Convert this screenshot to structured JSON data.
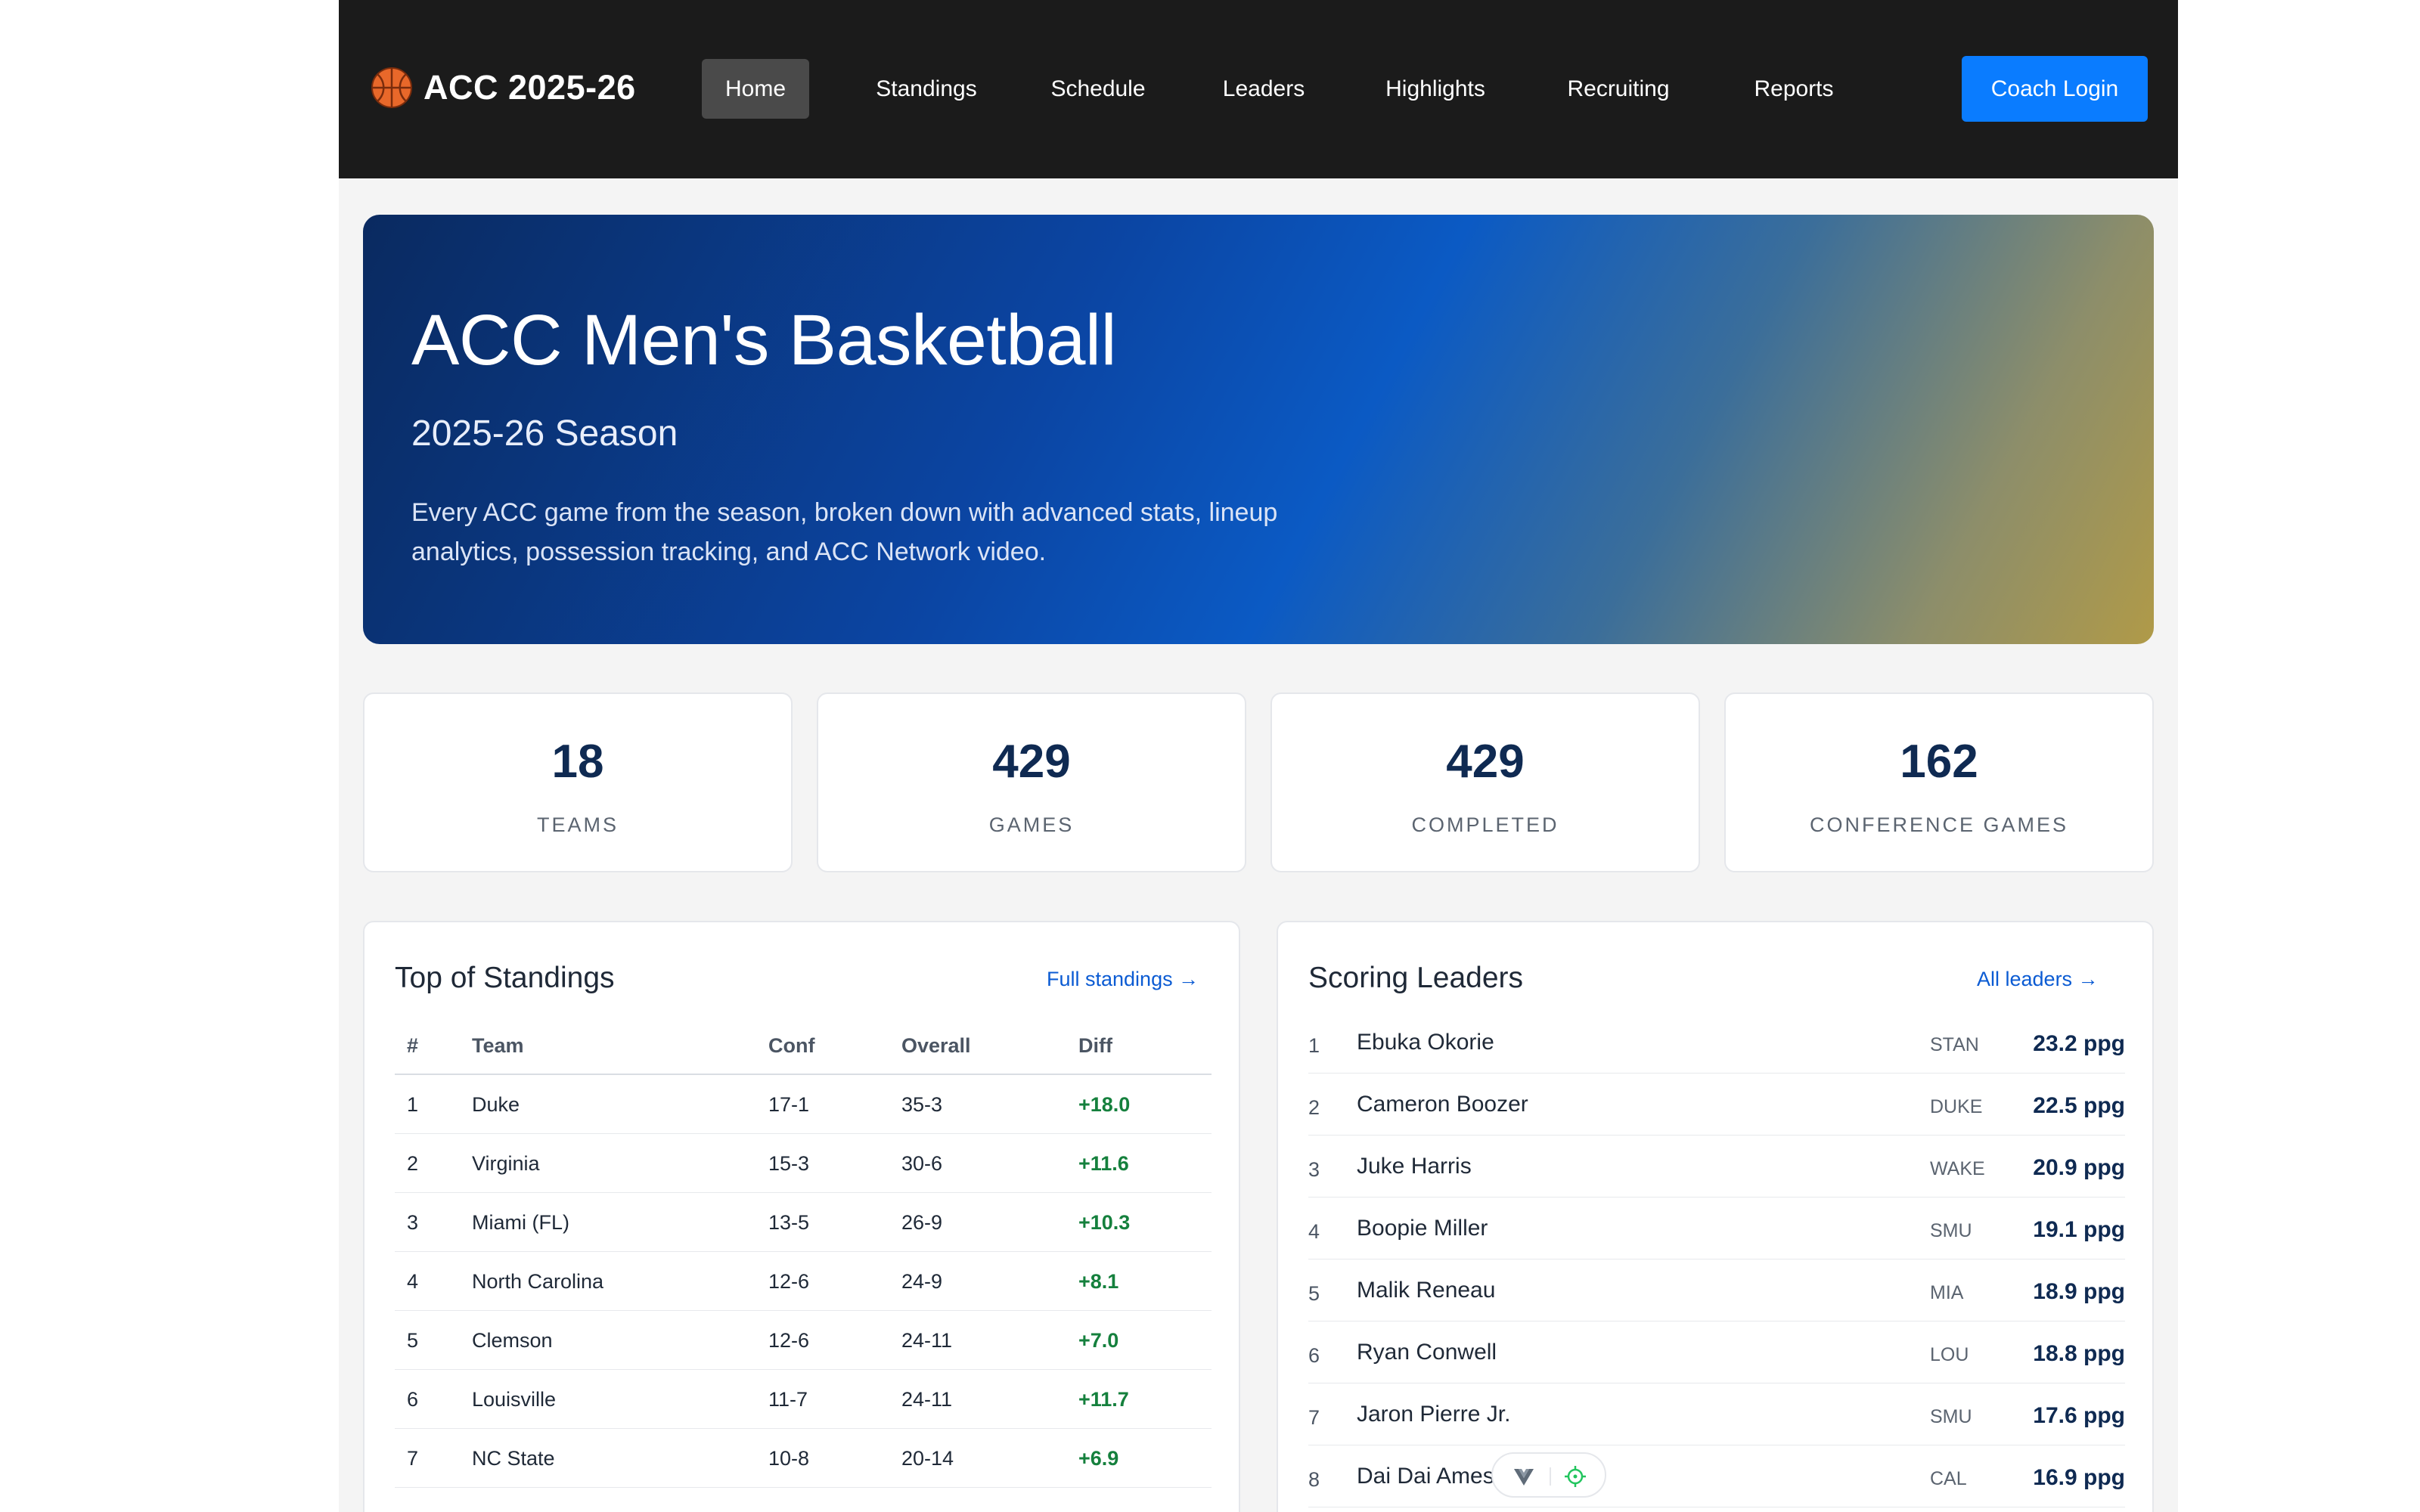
{
  "nav": {
    "brand": "ACC 2025-26",
    "brand_icon": "basketball-icon",
    "items": [
      {
        "label": "Home",
        "active": true
      },
      {
        "label": "Standings",
        "active": false
      },
      {
        "label": "Schedule",
        "active": false
      },
      {
        "label": "Leaders",
        "active": false
      },
      {
        "label": "Highlights",
        "active": false
      },
      {
        "label": "Recruiting",
        "active": false
      },
      {
        "label": "Reports",
        "active": false
      }
    ],
    "login_label": "Coach Login"
  },
  "hero": {
    "title": "ACC Men's Basketball",
    "subtitle": "2025-26 Season",
    "description": "Every ACC game from the season, broken down with advanced stats, lineup analytics, possession tracking, and ACC Network video."
  },
  "stats": [
    {
      "value": "18",
      "label": "TEAMS"
    },
    {
      "value": "429",
      "label": "GAMES"
    },
    {
      "value": "429",
      "label": "COMPLETED"
    },
    {
      "value": "162",
      "label": "CONFERENCE GAMES"
    }
  ],
  "standings": {
    "title": "Top of Standings",
    "link": "Full standings →",
    "columns": [
      "#",
      "Team",
      "Conf",
      "Overall",
      "Diff"
    ],
    "rows": [
      {
        "rank": "1",
        "team": "Duke",
        "conf": "17-1",
        "overall": "35-3",
        "diff": "+18.0"
      },
      {
        "rank": "2",
        "team": "Virginia",
        "conf": "15-3",
        "overall": "30-6",
        "diff": "+11.6"
      },
      {
        "rank": "3",
        "team": "Miami (FL)",
        "conf": "13-5",
        "overall": "26-9",
        "diff": "+10.3"
      },
      {
        "rank": "4",
        "team": "North Carolina",
        "conf": "12-6",
        "overall": "24-9",
        "diff": "+8.1"
      },
      {
        "rank": "5",
        "team": "Clemson",
        "conf": "12-6",
        "overall": "24-11",
        "diff": "+7.0"
      },
      {
        "rank": "6",
        "team": "Louisville",
        "conf": "11-7",
        "overall": "24-11",
        "diff": "+11.7"
      },
      {
        "rank": "7",
        "team": "NC State",
        "conf": "10-8",
        "overall": "20-14",
        "diff": "+6.9"
      }
    ]
  },
  "leaders": {
    "title": "Scoring Leaders",
    "link": "All leaders →",
    "rows": [
      {
        "rank": "1",
        "name": "Ebuka Okorie",
        "team": "STAN",
        "value": "23.2 ppg"
      },
      {
        "rank": "2",
        "name": "Cameron Boozer",
        "team": "DUKE",
        "value": "22.5 ppg"
      },
      {
        "rank": "3",
        "name": "Juke Harris",
        "team": "WAKE",
        "value": "20.9 ppg"
      },
      {
        "rank": "4",
        "name": "Boopie Miller",
        "team": "SMU",
        "value": "19.1 ppg"
      },
      {
        "rank": "5",
        "name": "Malik Reneau",
        "team": "MIA",
        "value": "18.9 ppg"
      },
      {
        "rank": "6",
        "name": "Ryan Conwell",
        "team": "LOU",
        "value": "18.8 ppg"
      },
      {
        "rank": "7",
        "name": "Jaron Pierre Jr.",
        "team": "SMU",
        "value": "17.6 ppg"
      },
      {
        "rank": "8",
        "name": "Dai Dai Ames",
        "team": "CAL",
        "value": "16.9 ppg"
      }
    ]
  },
  "floating_toolbar": {
    "icons": [
      "vue-devtools-icon",
      "crosshair-target-icon"
    ]
  },
  "colors": {
    "nav_bg": "#1b1b1b",
    "accent": "#0a7cff",
    "positive_diff": "#15803d",
    "stat_value": "#0f2a52",
    "link": "#0b5bd3"
  }
}
